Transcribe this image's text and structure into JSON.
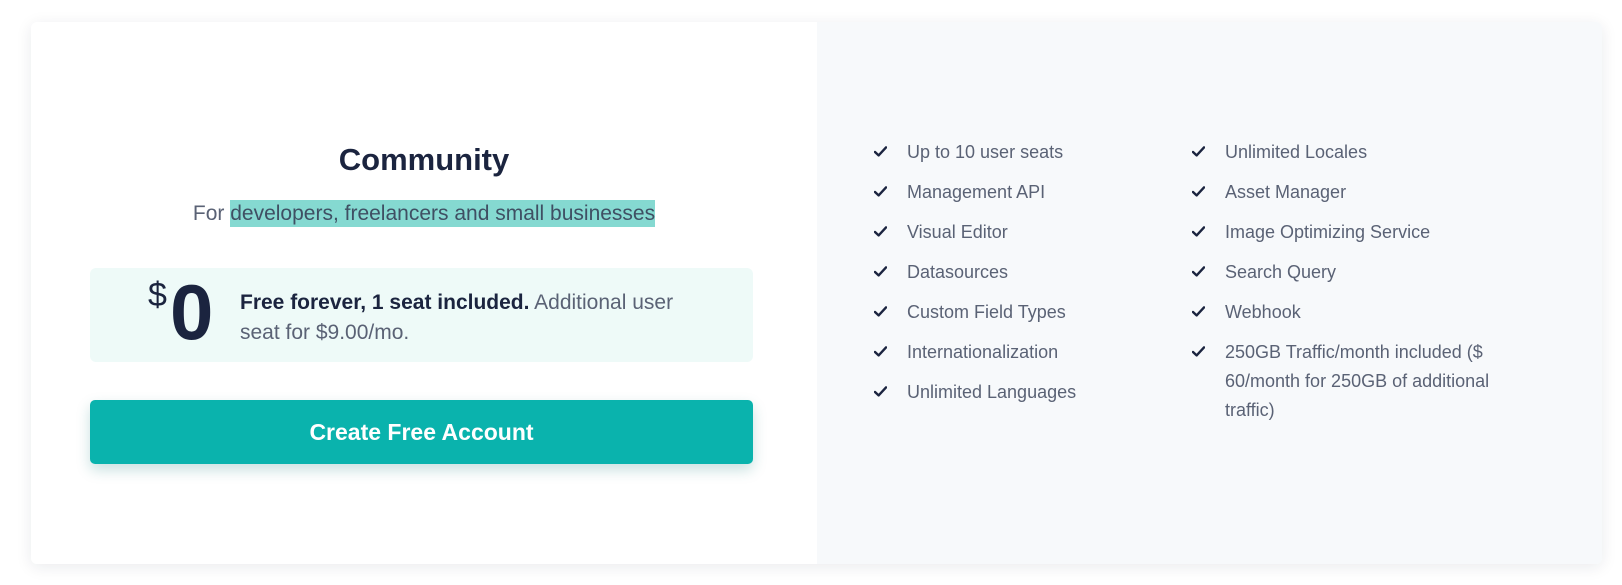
{
  "plan": {
    "title": "Community",
    "subtitle_prefix": "For ",
    "subtitle_highlight": "developers, freelancers and small businesses",
    "price": {
      "currency": "$",
      "amount": "0",
      "text_strong": "Free forever, 1 seat included.",
      "text_rest": " Additional user seat for $9.00/mo."
    },
    "cta_label": "Create Free Account"
  },
  "features": {
    "column_1": [
      "Up to 10 user seats",
      "Management API",
      "Visual Editor",
      "Datasources",
      "Custom Field Types",
      "Internationalization",
      "Unlimited Languages"
    ],
    "column_2": [
      "Unlimited Locales",
      "Asset Manager",
      "Image Optimizing Service",
      "Search Query",
      "Webhook",
      "250GB Traffic/month included ($ 60/month for 250GB of additional traffic)"
    ]
  },
  "icons": {
    "feature_bullet": "check-icon"
  },
  "colors": {
    "accent": "#0ab3ad",
    "text_dark": "#1b243f",
    "text_muted": "#5a6275",
    "highlight": "#85d9d1",
    "price_box_bg": "#eefaf8",
    "features_bg": "#f7f9fb"
  }
}
